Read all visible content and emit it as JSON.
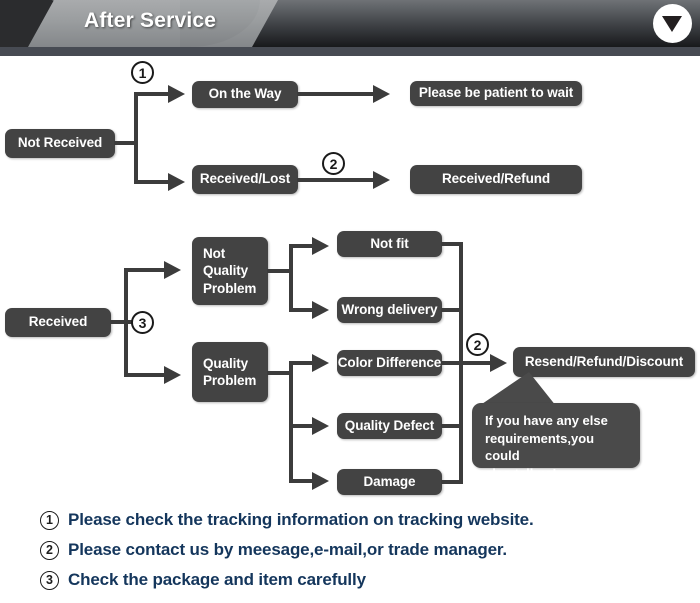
{
  "header": {
    "title": "After Service",
    "toggle_icon": "chevron-down-triangle-icon",
    "accent_color": "#474b53",
    "band_color": "#9a9d9f",
    "dark_color": "#2b2c2e"
  },
  "flow": {
    "box_color": "#434343",
    "line_color": "#3c3c3c",
    "section_not_received": {
      "root": "Not Received",
      "marker": "1",
      "branches": [
        {
          "stage": "On the Way",
          "outcome": "Please be patient to wait",
          "marker": ""
        },
        {
          "stage": "Received/Lost",
          "outcome": "Received/Refund",
          "marker": "2"
        }
      ]
    },
    "section_received": {
      "root": "Received",
      "marker": "3",
      "marker_outcome": "2",
      "categories": [
        {
          "name": "Not Quality Problem",
          "name_lines": [
            "Not",
            "Quality",
            "Problem"
          ],
          "reasons": [
            "Not fit",
            "Wrong delivery"
          ]
        },
        {
          "name": "Quality Problem",
          "name_lines": [
            "Quality",
            "Problem"
          ],
          "reasons": [
            "Color Difference",
            "Quality Defect",
            "Damage"
          ]
        }
      ],
      "outcome": "Resend/Refund/Discount",
      "callout": "If you have any else requirements,you could also tell us!",
      "callout_lines": [
        "If you have any else",
        "requirements,you could",
        "also tell us!"
      ]
    }
  },
  "notes": {
    "text_color": "#14365c",
    "items": [
      {
        "marker": "1",
        "text": "Please check the tracking information on tracking website."
      },
      {
        "marker": "2",
        "text": "Please contact us by meesage,e-mail,or trade manager."
      },
      {
        "marker": "3",
        "text": "Check the package and item carefully"
      }
    ]
  }
}
